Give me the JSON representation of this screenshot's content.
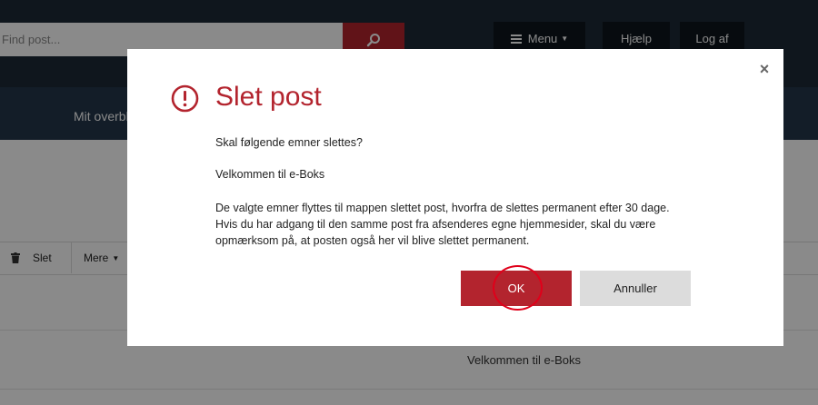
{
  "header": {
    "search_placeholder": "Find post...",
    "menu_label": "Menu",
    "help_label": "Hjælp",
    "logout_label": "Log af"
  },
  "nav": {
    "item_label": "Mit overblik"
  },
  "toolbar": {
    "delete_label": "Slet",
    "more_label": "Mere"
  },
  "list": {
    "row_subject": "Velkommen til e-Boks"
  },
  "dialog": {
    "title": "Slet post",
    "question": "Skal følgende emner slettes?",
    "item": "Velkommen til e-Boks",
    "info": "De valgte emner flyttes til mappen slettet post, hvorfra de slettes permanent efter 30 dage. Hvis du har adgang til den samme post fra afsenderes egne hjemmesider, skal du være opmærksom på, at posten også her vil blive slettet permanent.",
    "ok_label": "OK",
    "cancel_label": "Annuller",
    "close_glyph": "×"
  },
  "colors": {
    "accent": "#b3242e",
    "header_bg": "#1d2a37",
    "nav_bg": "#24374a",
    "highlight_circle": "#e0001a"
  },
  "icons": {
    "search": "search-icon",
    "menu": "hamburger-icon",
    "delete": "trash-icon",
    "alert": "exclamation-circle-icon",
    "close": "close-icon"
  }
}
